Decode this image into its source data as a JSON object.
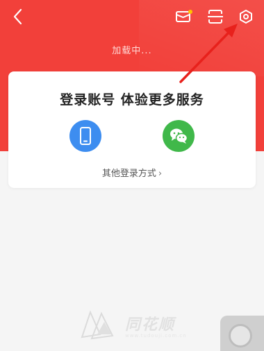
{
  "header": {
    "loading_text": "加载中...",
    "icons": [
      "back-icon",
      "mail-icon",
      "scan-icon",
      "settings-icon"
    ],
    "brand_color": "#f2403a"
  },
  "login_card": {
    "title": "登录账号 体验更多服务",
    "methods": [
      {
        "name": "phone",
        "icon": "phone-icon",
        "color": "#3d8df0"
      },
      {
        "name": "wechat",
        "icon": "wechat-icon",
        "color": "#40b84a"
      }
    ],
    "other_login_label": "其他登录方式",
    "other_login_chevron": "›"
  },
  "annotation": {
    "arrow_color": "#e8211c"
  },
  "watermark": {
    "text": "同花顺",
    "url": "www.tudouji.com.cn"
  }
}
